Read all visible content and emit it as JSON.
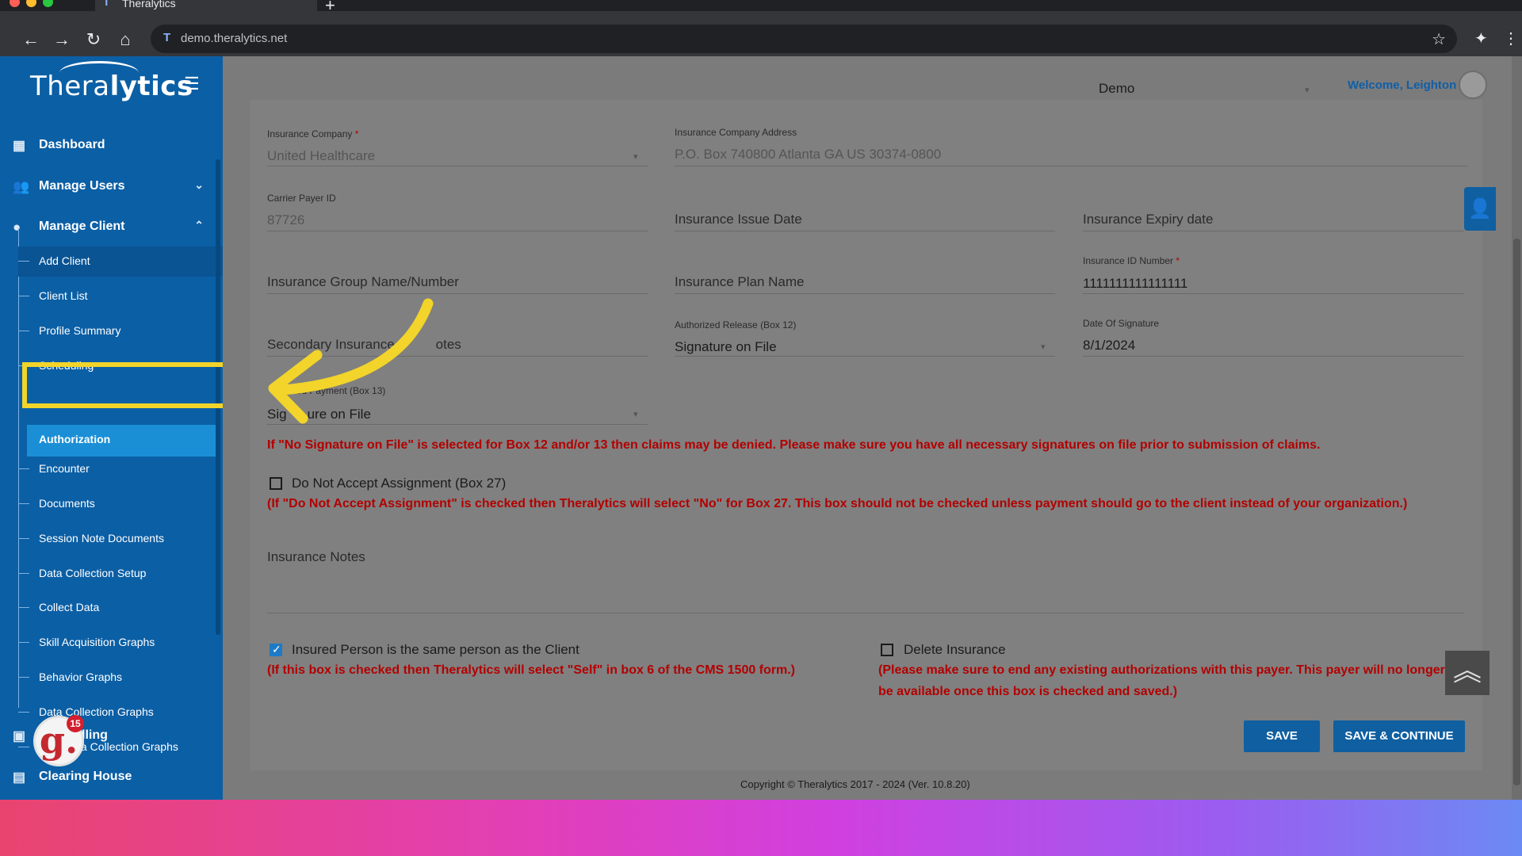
{
  "browser": {
    "tab_title": "Theralytics",
    "url": "demo.theralytics.net"
  },
  "app": {
    "logo_light": "Thera",
    "logo_bold": "lytics",
    "org_select": "Demo",
    "welcome": "Welcome, Leighton"
  },
  "sidebar": {
    "top_items": [
      {
        "label": "Dashboard"
      },
      {
        "label": "Manage Users"
      },
      {
        "label": "Manage Client"
      }
    ],
    "sub_items": [
      {
        "label": "Add Client"
      },
      {
        "label": "Client List"
      },
      {
        "label": "Profile Summary"
      },
      {
        "label": "Scheduling"
      },
      {
        "label": "Authorization"
      },
      {
        "label": "Encounter"
      },
      {
        "label": "Documents"
      },
      {
        "label": "Session Note Documents"
      },
      {
        "label": "Data Collection Setup"
      },
      {
        "label": "Collect Data"
      },
      {
        "label": "Skill Acquisition Graphs"
      },
      {
        "label": "Behavior Graphs"
      },
      {
        "label": "Data Collection Graphs"
      },
      {
        "label": "Bulk Data Collection Graphs"
      }
    ],
    "billing_label": "lling",
    "clearing_house": "Clearing House",
    "badge_count": "15"
  },
  "form": {
    "insurance_company_label": "Insurance Company",
    "insurance_company_value": "United Healthcare",
    "insurance_company_address_label": "Insurance Company Address",
    "insurance_company_address_value": "P.O. Box 740800 Atlanta GA US 30374-0800",
    "carrier_payer_id_label": "Carrier Payer ID",
    "carrier_payer_id_value": "87726",
    "insurance_issue_date_ph": "Insurance Issue Date",
    "insurance_expiry_date_ph": "Insurance Expiry date",
    "group_name_ph": "Insurance Group Name/Number",
    "plan_name_ph": "Insurance Plan Name",
    "insurance_id_label": "Insurance ID Number",
    "insurance_id_value": "1111111111111111",
    "secondary_notes_left": "Secondary Insurance",
    "secondary_notes_right": "otes",
    "authorized_release_label": "Authorized Release (Box 12)",
    "authorized_release_value": "Signature on File",
    "date_of_signature_label": "Date Of Signature",
    "date_of_signature_value": "8/1/2024",
    "authorized_payment_label": "rized Payment (Box 13)",
    "authorized_payment_value_left": "Sig",
    "authorized_payment_value_right": "ure on File",
    "warning_signature": "If \"No Signature on File\" is selected for Box 12 and/or 13 then claims may be denied. Please make sure you have all necessary signatures on file prior to submission of claims.",
    "do_not_accept_label": "Do Not Accept Assignment (Box 27)",
    "do_not_accept_warning": "(If \"Do Not Accept Assignment\" is checked then Theralytics will select \"No\" for Box 27. This box should not be checked unless payment should go to the client instead of your organization.)",
    "insurance_notes_ph": "Insurance Notes",
    "insured_same_label": "Insured Person is the same person as the Client",
    "insured_same_warning": "(If this box is checked then Theralytics will select \"Self\" in box 6 of the CMS 1500 form.)",
    "delete_insurance_label": "Delete Insurance",
    "delete_insurance_warning_1": "(Please make sure to end any existing authorizations with this payer. This payer will no longer",
    "delete_insurance_warning_2": "be available once this box is checked and saved.)",
    "save_label": "SAVE",
    "save_continue_label": "SAVE & CONTINUE"
  },
  "footer": {
    "copyright": "Copyright © Theralytics 2017 - 2024 (Ver. 10.8.20)"
  },
  "colors": {
    "sidebar_bg": "#0b5fa5",
    "active_item": "#1a8fd6",
    "highlight": "#f2d42a",
    "warning_text": "#b30000",
    "button_bg": "#0f5fa1"
  }
}
